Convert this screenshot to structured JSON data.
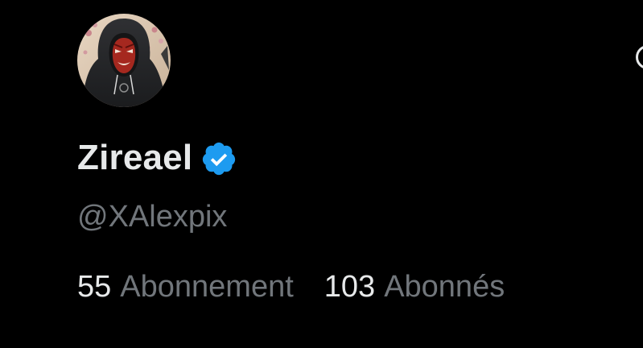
{
  "profile": {
    "display_name": "Zireael",
    "handle": "@XAlexpix",
    "verified": true,
    "avatar_icon": "hooded-red-oni-mask-avatar"
  },
  "stats": {
    "following": {
      "value": "55",
      "label": "Abonnement"
    },
    "followers": {
      "value": "103",
      "label": "Abonnés"
    }
  },
  "colors": {
    "background": "#000000",
    "primary_text": "#e7e9ea",
    "secondary_text": "#71767b",
    "verified_badge": "#1d9bf0"
  }
}
